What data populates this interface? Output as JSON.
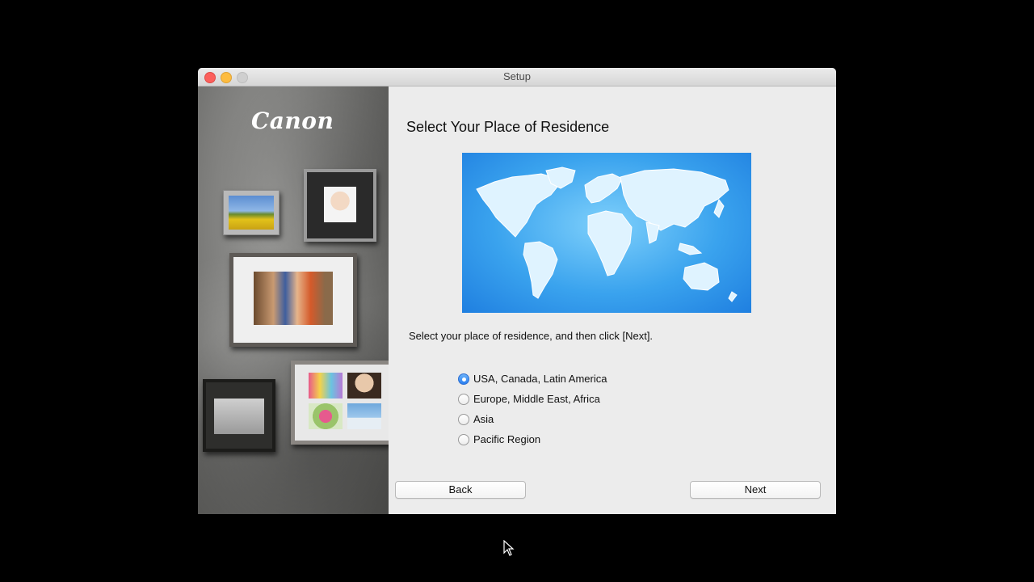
{
  "window": {
    "title": "Setup"
  },
  "brand": {
    "logo_text": "Canon"
  },
  "page": {
    "heading": "Select Your Place of Residence",
    "instruction": "Select your place of residence, and then click [Next]."
  },
  "regions": [
    {
      "label": "USA, Canada, Latin America",
      "selected": true
    },
    {
      "label": "Europe, Middle East, Africa",
      "selected": false
    },
    {
      "label": "Asia",
      "selected": false
    },
    {
      "label": "Pacific Region",
      "selected": false
    }
  ],
  "buttons": {
    "back_label": "Back",
    "next_label": "Next"
  },
  "colors": {
    "accent": "#2a7ff0",
    "map_blue": "#3aa3ee"
  }
}
